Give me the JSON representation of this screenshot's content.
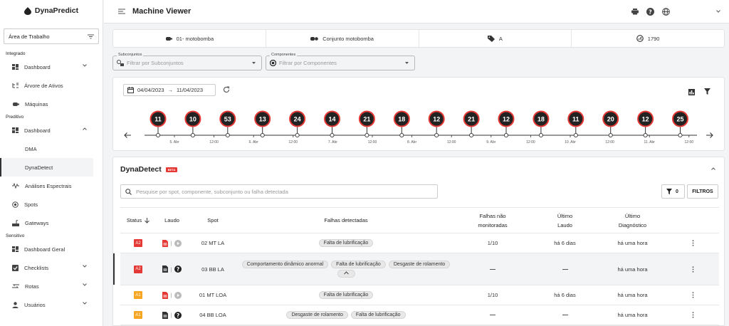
{
  "app": {
    "brand": "DynaPredict"
  },
  "sidebar": {
    "workspace": "Área de Trabalho",
    "sections": {
      "integrado": "Integrado",
      "preditivo": "Preditivo",
      "sensitivo": "Sensitivo"
    },
    "items": {
      "dashboard_integrado": "Dashboard",
      "arvore": "Árvore de Ativos",
      "maquinas": "Máquinas",
      "dashboard_preditivo": "Dashboard",
      "dma": "DMA",
      "dynadetect": "DynaDetect",
      "analises": "Análises Espectrais",
      "spots": "Spots",
      "gateways": "Gateways",
      "dashboard_geral": "Dashboard Geral",
      "checklists": "Checklists",
      "rotas": "Rotas",
      "usuarios": "Usuários"
    }
  },
  "topbar": {
    "title": "Machine Viewer"
  },
  "machine_info": {
    "machine": "01- motobomba",
    "group": "Conjunto motobomba",
    "tag": "A",
    "speed": "1790"
  },
  "filters": {
    "subconjuntos_label": "Subconjuntos",
    "subconjuntos_placeholder": "Filtrar por Subconjuntos",
    "componentes_label": "Componentes",
    "componentes_placeholder": "Filtrar por Componentes"
  },
  "timeline": {
    "date_start": "04/04/2023",
    "date_end": "11/04/2023",
    "date_sep": "→",
    "events": [
      "11",
      "10",
      "53",
      "13",
      "24",
      "14",
      "21",
      "18",
      "12",
      "21",
      "12",
      "18",
      "11",
      "20",
      "12",
      "25"
    ],
    "tick_labels": [
      "5. Abr",
      "12:00",
      "6. Abr",
      "12:00",
      "7. Abr",
      "12:00",
      "8. Abr",
      "12:00",
      "9. Abr",
      "12:00",
      "10. Abr",
      "12:00",
      "11. Abr",
      "12:00"
    ]
  },
  "dynadetect": {
    "title": "DynaDetect",
    "beta": "BETA",
    "search_placeholder": "Pesquise por spot, componente, subconjunto ou falha detectada",
    "filter_count": "0",
    "filters_label": "FILTROS",
    "columns": {
      "status": "Status",
      "laudo": "Laudo",
      "spot": "Spot",
      "falhas": "Falhas detectadas",
      "nao_mon_1": "Falhas não",
      "nao_mon_2": "monitoradas",
      "ultimo_laudo_1": "Último",
      "ultimo_laudo_2": "Laudo",
      "ultimo_diag_1": "Último",
      "ultimo_diag_2": "Diagnóstico"
    },
    "rows": [
      {
        "status": "A2",
        "spot": "02 MT LA",
        "falhas": [
          "Falta de lubrificação"
        ],
        "nao_monitoradas": "1/10",
        "ultimo_laudo": "há 6 dias",
        "ultimo_diagnostico": "há uma hora"
      },
      {
        "status": "A2",
        "spot": "03 BB LA",
        "falhas": [
          "Comportamento dinâmico anormal",
          "Falta de lubrificação",
          "Desgaste de rolamento"
        ],
        "nao_monitoradas": "",
        "ultimo_laudo": "",
        "ultimo_diagnostico": "há uma hora"
      },
      {
        "status": "A1",
        "spot": "01 MT LOA",
        "falhas": [
          "Falta de lubrificação"
        ],
        "nao_monitoradas": "1/10",
        "ultimo_laudo": "há 6 dias",
        "ultimo_diagnostico": "há uma hora"
      },
      {
        "status": "A1",
        "spot": "04 BB LOA",
        "falhas": [
          "Desgaste de rolamento",
          "Falta de lubrificação"
        ],
        "nao_monitoradas": "",
        "ultimo_laudo": "",
        "ultimo_diagnostico": "há uma hora"
      }
    ]
  },
  "colors": {
    "a2": "#e53935",
    "a1": "#f6a623",
    "laudo_red": "#e53935",
    "event_ring": "#e53935",
    "event_fill": "#222222",
    "accent_dark": "#333333"
  }
}
